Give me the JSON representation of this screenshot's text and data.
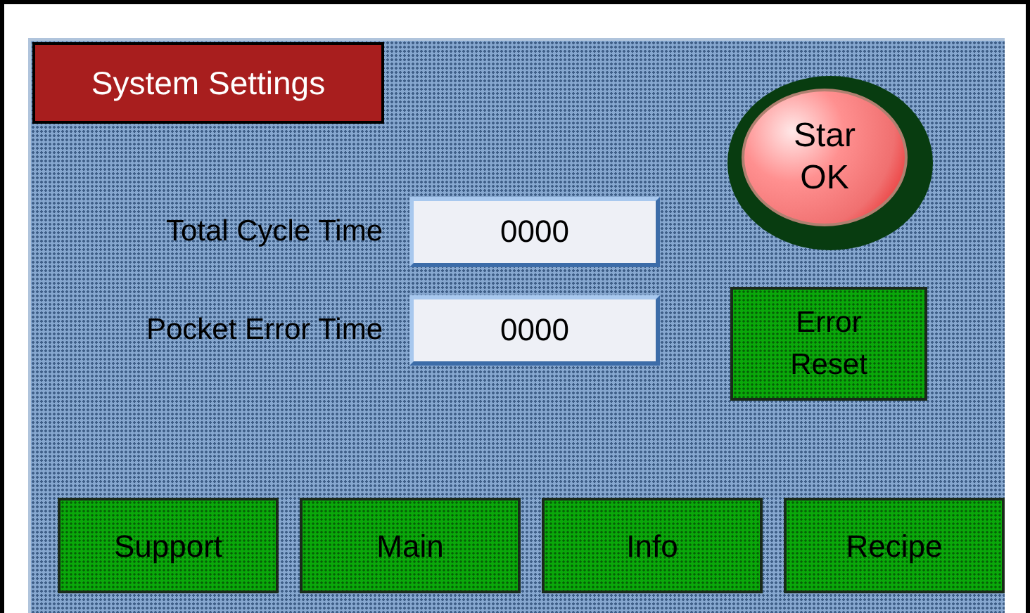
{
  "title": "System Settings",
  "start_button": {
    "lines": [
      "Star",
      "OK"
    ]
  },
  "fields": [
    {
      "label": "Total Cycle Time",
      "value": "0000"
    },
    {
      "label": "Pocket Error Time",
      "value": "0000"
    }
  ],
  "error_reset_button": {
    "lines": [
      "Error",
      "Reset"
    ]
  },
  "nav_buttons": [
    "Support",
    "Main",
    "Info",
    "Recipe"
  ]
}
